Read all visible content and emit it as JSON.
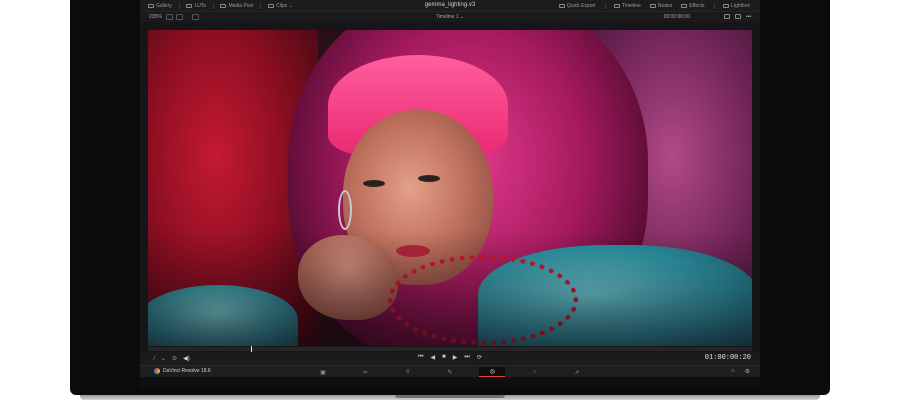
{
  "app": {
    "project_title": "gemma_lighting.v3",
    "brand_label": "DaVinci Resolve 18.6"
  },
  "toolbar": {
    "left_items": [
      {
        "label": "Gallery",
        "icon": "gallery-icon"
      },
      {
        "label": "LUTs",
        "icon": "luts-icon"
      },
      {
        "label": "Media Pool",
        "icon": "media-pool-icon"
      },
      {
        "label": "Clips",
        "icon": "clips-icon"
      }
    ],
    "right_items": [
      {
        "label": "Quick Export",
        "icon": "export-icon"
      },
      {
        "label": "Timeline",
        "icon": "timeline-icon"
      },
      {
        "label": "Nodes",
        "icon": "nodes-icon"
      },
      {
        "label": "Effects",
        "icon": "effects-icon"
      },
      {
        "label": "Lightbox",
        "icon": "lightbox-icon"
      }
    ]
  },
  "viewer": {
    "zoom": "235%",
    "timeline_name": "Timeline 1",
    "top_timecode": "00:00:00:00",
    "bottom_timecode": "01:00:00:20",
    "image_description_icon": "video-frame",
    "playhead_fraction": 0.17
  },
  "transport": {
    "controls": [
      "⏮",
      "◀",
      "■",
      "▶",
      "⏭",
      "⟳"
    ],
    "tool_icons": [
      "wand-icon",
      "chevron-down-icon",
      "dropper-icon",
      "volume-icon"
    ]
  },
  "pages": {
    "tabs": [
      {
        "icon": "media-page-icon",
        "glyph": "▣",
        "active": false
      },
      {
        "icon": "cut-page-icon",
        "glyph": "✂",
        "active": false
      },
      {
        "icon": "edit-page-icon",
        "glyph": "≡",
        "active": false
      },
      {
        "icon": "fusion-page-icon",
        "glyph": "✎",
        "active": false
      },
      {
        "icon": "color-page-icon",
        "glyph": "◎",
        "active": true
      },
      {
        "icon": "fairlight-page-icon",
        "glyph": "♪",
        "active": false
      },
      {
        "icon": "deliver-page-icon",
        "glyph": "➚",
        "active": false
      }
    ],
    "right_icons": [
      {
        "icon": "home-icon",
        "glyph": "⌂"
      },
      {
        "icon": "settings-icon",
        "glyph": "⚙"
      }
    ]
  },
  "colors": {
    "accent_active_page": "#e0423a",
    "app_background": "#161618"
  }
}
